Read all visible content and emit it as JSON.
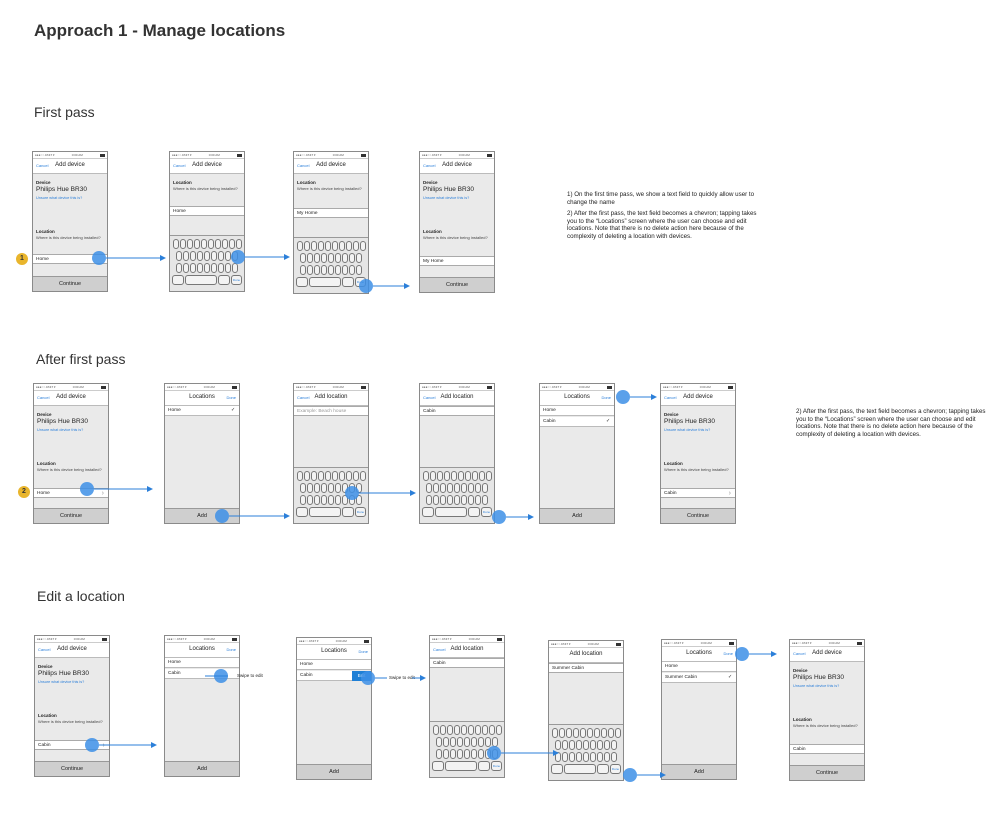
{
  "page_title": "Approach 1 - Manage locations",
  "sections": {
    "first_pass": "First pass",
    "after_first_pass": "After first pass",
    "edit_location": "Edit a location"
  },
  "status_bar": {
    "carrier": "●●●○○ AT&T ▾",
    "time": "0:00 AM"
  },
  "labels": {
    "cancel": "Cancel",
    "done": "Done",
    "add_device": "Add device",
    "add_location": "Add location",
    "locations": "Locations",
    "device": "Device",
    "device_name": "Philips Hue BR30",
    "unsure": "Unsure what device this is?",
    "location": "Location",
    "location_question": "Where is this device being installed?",
    "continue": "Continue",
    "add": "Add",
    "edit": "Edit",
    "swipe_to_edit": "Swipe to edit",
    "kb_done": "Done",
    "chevron": "›",
    "check": "✓"
  },
  "values": {
    "home": "Home",
    "my_home": "My Home",
    "cabin": "Cabin",
    "summer_cabin": "Summer Cabin",
    "beach_placeholder": "Example: Beach house"
  },
  "badges": {
    "one": "1",
    "two": "2"
  },
  "notes": {
    "note1": "1) On the first time pass, we show a text field to quickly allow user to change the name",
    "note2": "2) After the first pass, the text field becomes a chevron; tapping takes you to the “Locations” screen where the user can choose and edit locations. Note that there is no delete action here because of the complexity of deleting a location with devices.",
    "note3": "2) After the first pass, the text field becomes a chevron; tapping takes you to the “Locations” screen where the user can choose and edit locations. Note that there is no delete action here because of the complexity of deleting a location with devices."
  },
  "colors": {
    "accent": "#2b7fd9",
    "tap": "#3d8fe6",
    "badge": "#e9b52c",
    "edit_button": "#1e7fd6"
  }
}
